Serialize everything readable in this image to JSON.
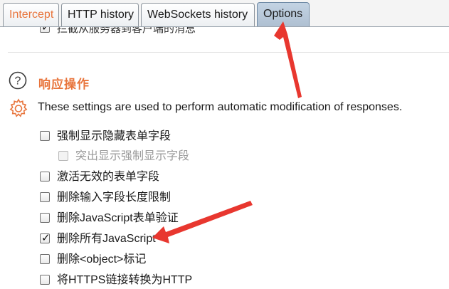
{
  "tabs": [
    {
      "label": "Intercept"
    },
    {
      "label": "HTTP history"
    },
    {
      "label": "WebSockets history"
    },
    {
      "label": "Options"
    }
  ],
  "prev_option": {
    "label": "拦截从服务器到客户端的消息",
    "checked": true
  },
  "section": {
    "title": "响应操作",
    "description": "These settings are used to perform automatic modification of responses."
  },
  "options": [
    {
      "label": "强制显示隐藏表单字段",
      "checked": false,
      "enabled": true
    },
    {
      "label": "突出显示强制显示字段",
      "checked": false,
      "enabled": false
    },
    {
      "label": "激活无效的表单字段",
      "checked": false,
      "enabled": true
    },
    {
      "label": "删除输入字段长度限制",
      "checked": false,
      "enabled": true
    },
    {
      "label": "删除JavaScript表单验证",
      "checked": false,
      "enabled": true
    },
    {
      "label": "删除所有JavaScript",
      "checked": true,
      "enabled": true
    },
    {
      "label": "删除<object>标记",
      "checked": false,
      "enabled": true
    },
    {
      "label": "将HTTPS链接转换为HTTP",
      "checked": false,
      "enabled": true
    }
  ],
  "colors": {
    "accent": "#e8743b",
    "annotation": "#e8372f",
    "selected_tab": "#b4c5d7"
  }
}
